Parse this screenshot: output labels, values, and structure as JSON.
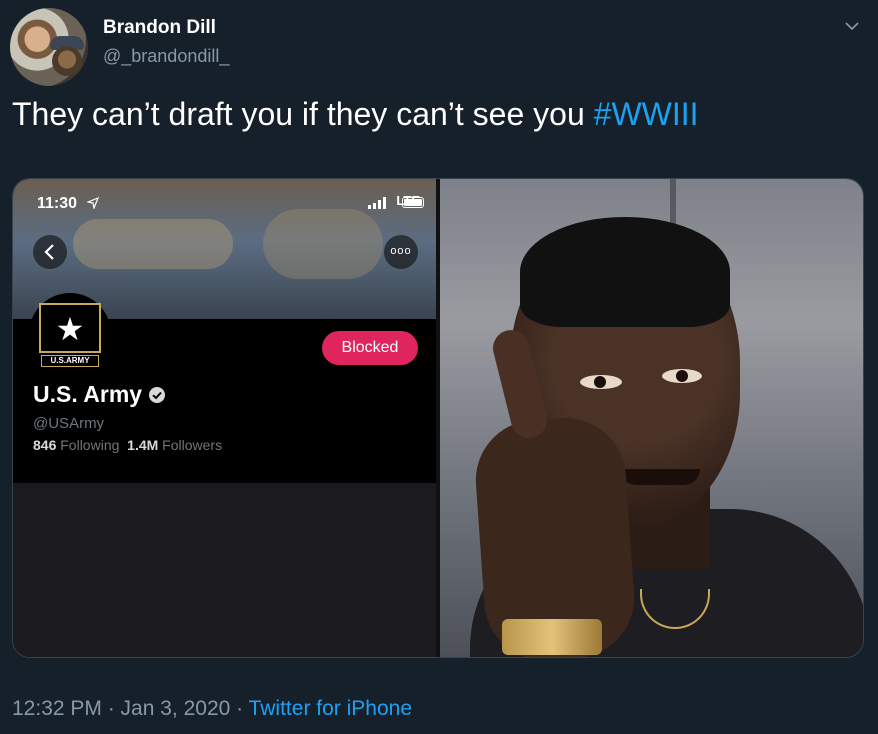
{
  "tweet": {
    "author_name": "Brandon Dill",
    "author_handle": "@_brandondill_",
    "text_main": "They can’t draft you if they can’t see you ",
    "hashtag": "#WWIII",
    "timestamp": "12:32 PM · Jan 3, 2020 · ",
    "source": "Twitter for iPhone"
  },
  "embedded_screenshot": {
    "status_time": "11:30",
    "network": "LTE",
    "more_label": "ooo",
    "badge_label": "U.S.ARMY",
    "blocked_label": "Blocked",
    "profile_name": "U.S. Army",
    "profile_handle": "@USArmy",
    "following_count": "846",
    "following_label": " Following",
    "followers_count": "1.4M",
    "followers_label": " Followers"
  },
  "colors": {
    "background": "#15202b",
    "accent": "#1da1f2",
    "blocked": "#e0245e",
    "secondary_text": "#8899a6"
  },
  "icons": [
    "chevron-down-icon",
    "location-arrow-icon",
    "signal-icon",
    "battery-icon",
    "back-arrow-icon",
    "more-icon",
    "verified-badge-icon",
    "army-star-icon"
  ]
}
